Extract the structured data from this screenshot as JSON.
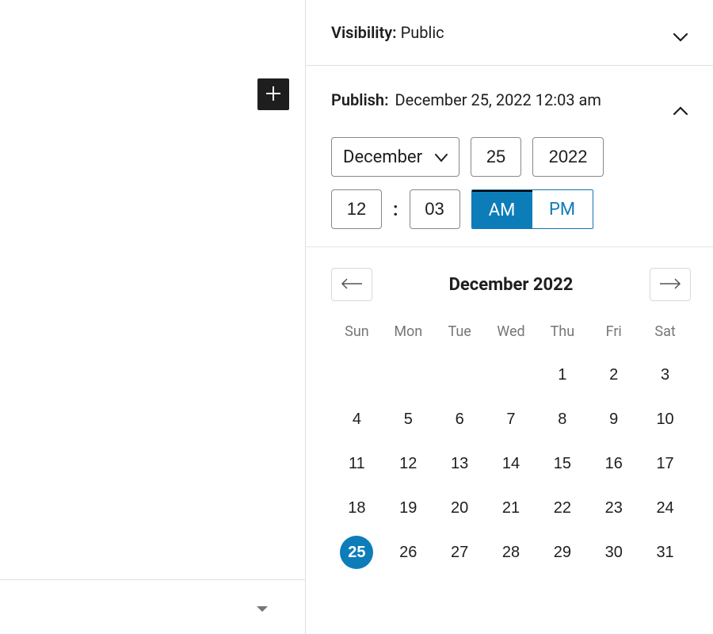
{
  "visibility": {
    "label": "Visibility:",
    "value": "Public"
  },
  "publish": {
    "label": "Publish:",
    "value": "December 25, 2022 12:03 am"
  },
  "datetime": {
    "month": "December",
    "day": "25",
    "year": "2022",
    "hour": "12",
    "minute": "03",
    "am": "AM",
    "pm": "PM",
    "meridiem_selected": "AM",
    "colon": ":"
  },
  "calendar": {
    "title": "December 2022",
    "dow": [
      "Sun",
      "Mon",
      "Tue",
      "Wed",
      "Thu",
      "Fri",
      "Sat"
    ],
    "leading_blanks": 4,
    "days_in_month": 31,
    "selected_day": 25
  },
  "colors": {
    "accent": "#0d7db9"
  }
}
